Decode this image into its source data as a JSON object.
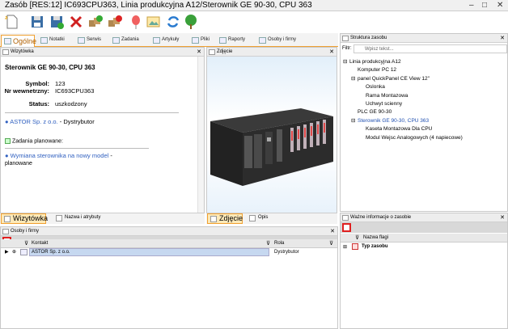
{
  "window": {
    "title": "Zasób [RES:12] IC693CPU363, Linia produkcyjna A12/Sterownik GE 90-30, CPU 363",
    "min": "–",
    "max": "□",
    "close": "✕"
  },
  "toolbar": {
    "icons": [
      "new-icon",
      "save-icon",
      "save-as-icon",
      "delete-icon",
      "add-group-icon",
      "remove-group-icon",
      "balloon-icon",
      "image-icon",
      "refresh-icon",
      "tree-icon"
    ]
  },
  "tabs": [
    {
      "label": "Ogólne"
    },
    {
      "label": "Notatki"
    },
    {
      "label": "Serwis"
    },
    {
      "label": "Zadania"
    },
    {
      "label": "Artykuły"
    },
    {
      "label": "Pliki"
    },
    {
      "label": "Raporty"
    },
    {
      "label": "Osoby i firmy"
    }
  ],
  "wizytowka": {
    "title": "Wizytówka",
    "heading": "Sterownik GE 90-30, CPU 363",
    "fields": [
      {
        "label": "Symbol:",
        "value": "123"
      },
      {
        "label": "Nr wewnetrzny:",
        "value": "IC693CPU363"
      },
      {
        "label": "Status:",
        "value": "uszkodzony"
      }
    ],
    "company_link": "ASTOR Sp. z o.o.",
    "company_role": " - Dystrybutor",
    "tasks_label": "Zadania planowane:",
    "task_link": "Wymiana sterownika na nowy model",
    "task_sep": " -",
    "task_status": "planowane",
    "tab1": "Wizytówka",
    "tab2": "Nazwa i atrybuty"
  },
  "zdjecie": {
    "title": "Zdjęcie",
    "tab1": "Zdjęcie",
    "tab2": "Opis"
  },
  "struktura": {
    "title": "Struktura zasobu",
    "filter_label": "Filtr:",
    "filter_placeholder": "Wpisz tekst...",
    "nodes": [
      {
        "label": "Linia produkcyjna A12",
        "depth": 0,
        "exp": "⊟"
      },
      {
        "label": "Komputer PC 12",
        "depth": 1,
        "exp": ""
      },
      {
        "label": "panel QuickPanel CE View 12\"",
        "depth": 1,
        "exp": "⊟"
      },
      {
        "label": "Oslonka",
        "depth": 2,
        "exp": ""
      },
      {
        "label": "Rama Montazowa",
        "depth": 2,
        "exp": ""
      },
      {
        "label": "Uchwyt scienny",
        "depth": 2,
        "exp": ""
      },
      {
        "label": "PLC GE 90-30",
        "depth": 1,
        "exp": ""
      },
      {
        "label": "Sterownik GE 90-30, CPU 363",
        "depth": 1,
        "exp": "⊟",
        "selected": true
      },
      {
        "label": "Kaseta Montazowa Dla CPU",
        "depth": 2,
        "exp": ""
      },
      {
        "label": "Modul Wejsc Analogowych (4 napiecowe)",
        "depth": 2,
        "exp": ""
      }
    ]
  },
  "osoby": {
    "title": "Osoby i firmy",
    "col_kontakt": "Kontakt",
    "col_rola": "Rola",
    "rows": [
      {
        "kontakt": "ASTOR Sp. z o.o.",
        "rola": "Dystrybutor"
      }
    ]
  },
  "wazne": {
    "title": "Ważne informacje o zasobie",
    "col_flag": "Nazwa flagi",
    "group": "Typ zasobu"
  }
}
